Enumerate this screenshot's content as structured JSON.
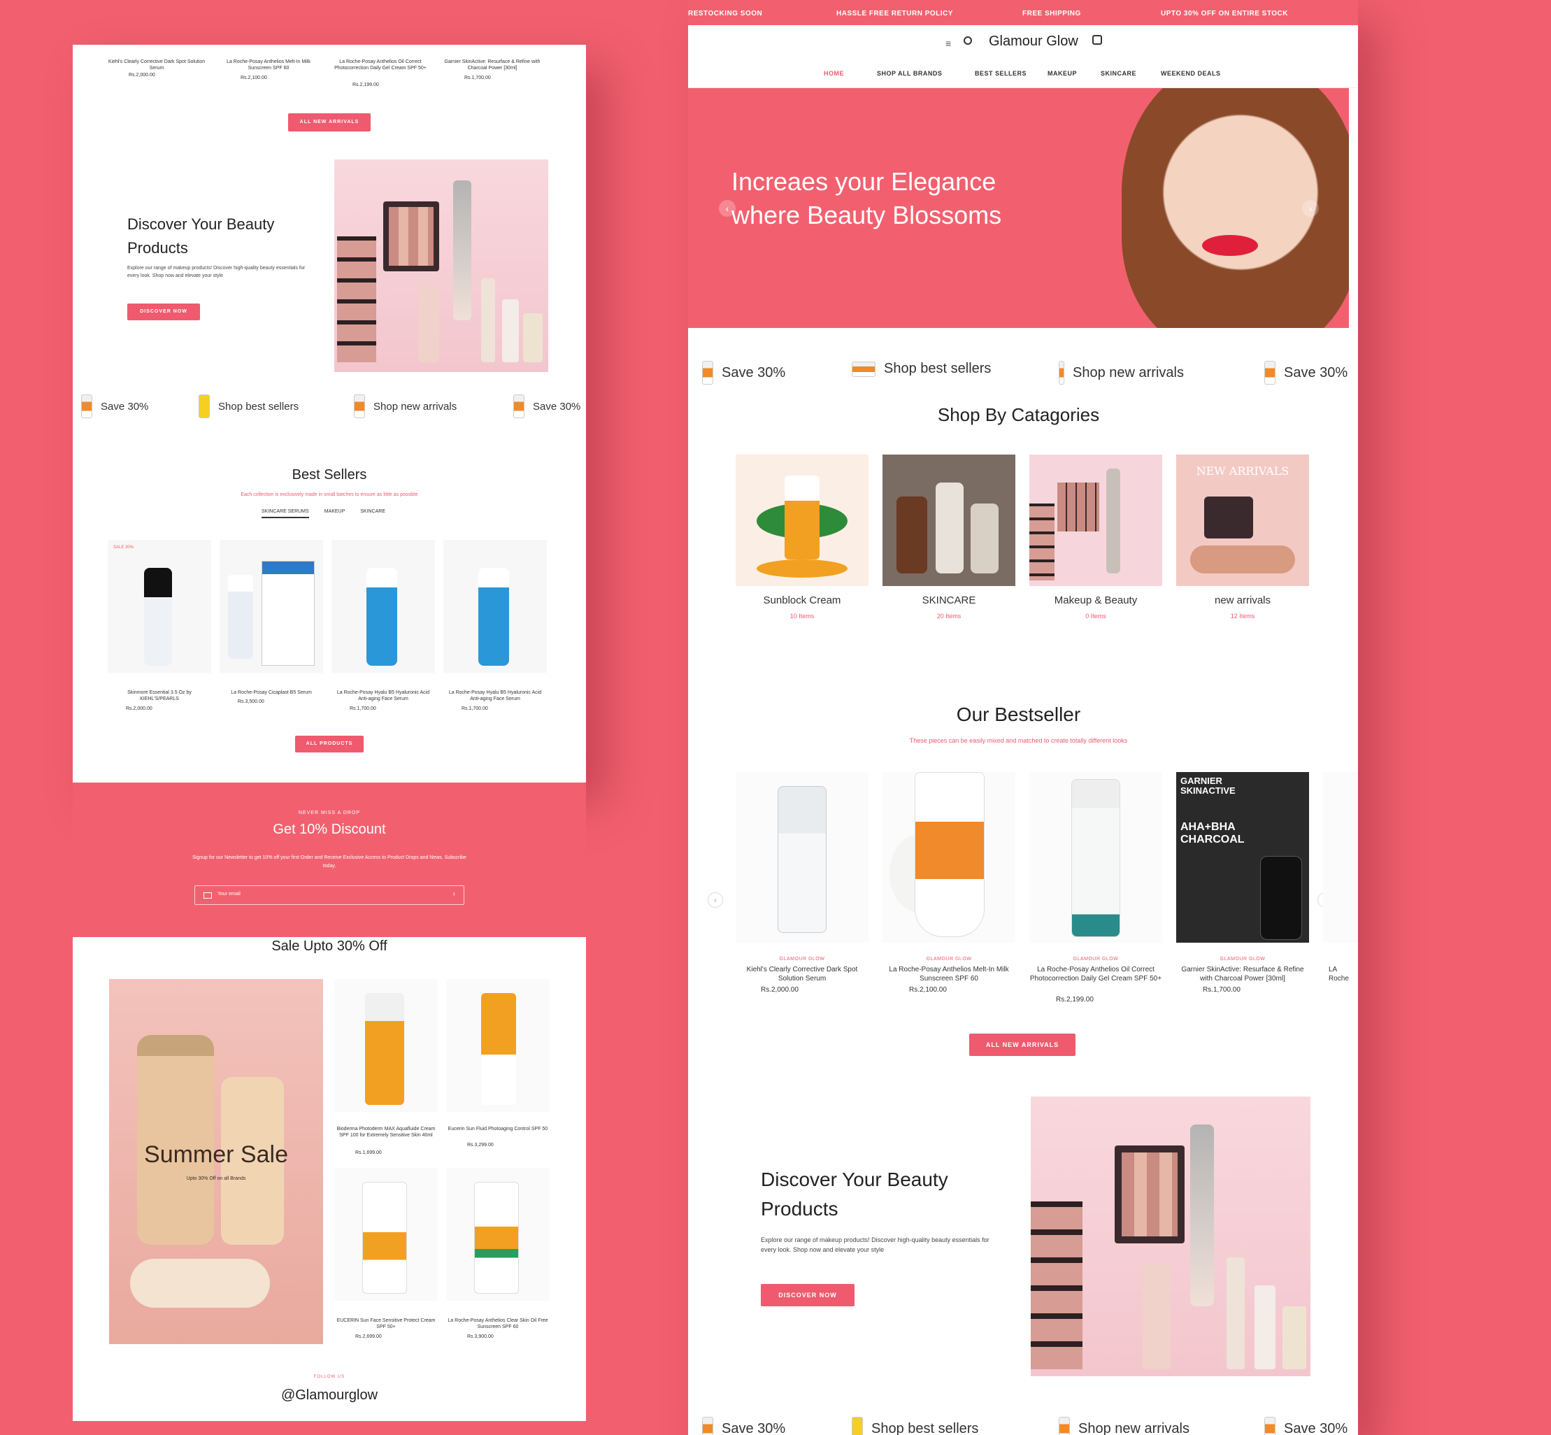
{
  "brand": {
    "name": "Glamour Glow"
  },
  "announcement": [
    "RESTOCKING SOON",
    "HASSLE FREE RETURN POLICY",
    "FREE SHIPPING",
    "UPTO 30% OFF ON ENTIRE STOCK"
  ],
  "nav": [
    "HOME",
    "SHOP ALL BRANDS",
    "BEST SELLERS",
    "MAKEUP",
    "SKINCARE",
    "WEEKEND DEALS"
  ],
  "hero": {
    "line1": "Increaes your Elegance",
    "line2": "where Beauty Blossoms"
  },
  "strip": [
    "Save 30%",
    "Shop best sellers",
    "Shop new arrivals",
    "Save 30%"
  ],
  "categories": {
    "title": "Shop By Catagories",
    "items": [
      {
        "name": "Sunblock Cream",
        "count": "10 Items"
      },
      {
        "name": "SKINCARE",
        "count": "20 Items"
      },
      {
        "name": "Makeup & Beauty",
        "count": "0 Items"
      },
      {
        "name": "new arrivals",
        "count": "12 Items",
        "overlay": "NEW ARRIVALS"
      }
    ]
  },
  "bestseller": {
    "title": "Our Bestseller",
    "subtitle": "These pieces can be easily mixed and matched to create totally different looks",
    "brand_tag": "GLAMOUR GLOW",
    "items": [
      {
        "name": "Kiehl's Clearly Corrective Dark Spot Solution Serum",
        "price": "Rs.2,000.00"
      },
      {
        "name": "La Roche-Posay Anthelios Melt-In Milk Sunscreen SPF 60",
        "price": "Rs.2,100.00"
      },
      {
        "name": "La Roche-Posay Anthelios Oil Correct Photocorrection Daily Gel Cream SPF 50+",
        "price": "Rs.2,199.00"
      },
      {
        "name": "Garnier SkinActive: Resurface & Refine with Charcoal Power [30ml]",
        "price": "Rs.1,700.00"
      }
    ],
    "cutoff": "LA Roche",
    "button": "ALL NEW ARRIVALS",
    "garnier_label": "GARNIER SKINACTIVE",
    "garnier_aha": "AHA+BHA CHARCOAL"
  },
  "discover": {
    "title_line1": "Discover Your Beauty",
    "title_line2": "Products",
    "text": "Explore our range of makeup products! Discover high-quality beauty essentials for every look. Shop now and elevate your style",
    "button": "DISCOVER NOW"
  },
  "left": {
    "top_products": [
      {
        "name": "Kiehl's Clearly Corrective Dark Spot Solution Serum",
        "price": "Rs.2,000.00"
      },
      {
        "name": "La Roche-Posay Anthelios Melt-In Milk Sunscreen SPF 60",
        "price": "Rs.2,100.00"
      },
      {
        "name": "La Roche-Posay Anthelios Oil Correct Photocorrection Daily Gel Cream SPF 50+",
        "price": "Rs.2,199.00"
      },
      {
        "name": "Garnier SkinActive: Resurface & Refine with Charcoal Power [30ml]",
        "price": "Rs.1,700.00"
      }
    ],
    "top_button": "ALL NEW ARRIVALS",
    "best": {
      "title": "Best Sellers",
      "subtitle": "Each collection is exclusively made in small batches to ensure as little as possible",
      "tabs": [
        "SKINCARE SERUMS",
        "MAKEUP",
        "SKINCARE"
      ],
      "badge": "SALE 30%",
      "items": [
        {
          "name": "Skinmore Essential 3.5 Oz by KIEHL'S/PEARLS",
          "price": "Rs.2,000.00"
        },
        {
          "name": "La Roche-Posay Cicaplast B5 Serum",
          "price": "Rs.3,500.00"
        },
        {
          "name": "La Roche-Posay Hyalu B5 Hyaluronic Acid Anti-aging Face Serum",
          "price": "Rs.1,700.00"
        },
        {
          "name": "La Roche-Posay Hyalu B5 Hyaluronic Acid Anti-aging Face Serum",
          "price": "Rs.1,700.00"
        }
      ],
      "button": "ALL PRODUCTS"
    },
    "newsletter": {
      "kicker": "NEVER MISS A DROP",
      "title": "Get 10% Discount",
      "text": "Signup for our Newsletter to get 10% off your first Order and Receive Exclusive Access to Product Drops and News. Subscribe today.",
      "placeholder": "Your email"
    },
    "sale": {
      "title": "Sale Upto 30% Off",
      "banner_title": "Summer Sale",
      "banner_sub": "Upto 30% Off on all Brands",
      "items": [
        {
          "name": "Bioderma Photoderm MAX Aquafluide Cream SPF 100 for Extremely Sensitive Skin 40ml",
          "price": "Rs.1,699.00"
        },
        {
          "name": "Eucerin Sun Fluid Photoaging Control SPF 50",
          "price": "Rs.3,299.00"
        },
        {
          "name": "EUCERIN Sun Face Sensitive Protect Cream SPF 50+",
          "price": "Rs.2,699.00"
        },
        {
          "name": "La Roche-Posay Anthelios Clear Skin Oil Free Sunscreen SPF 60",
          "price": "Rs.3,900.00"
        }
      ],
      "follow": "FOLLOW US",
      "handle": "@Glamourglow"
    }
  },
  "colors": {
    "accent": "#ef5a6e",
    "background": "#f2606f"
  }
}
